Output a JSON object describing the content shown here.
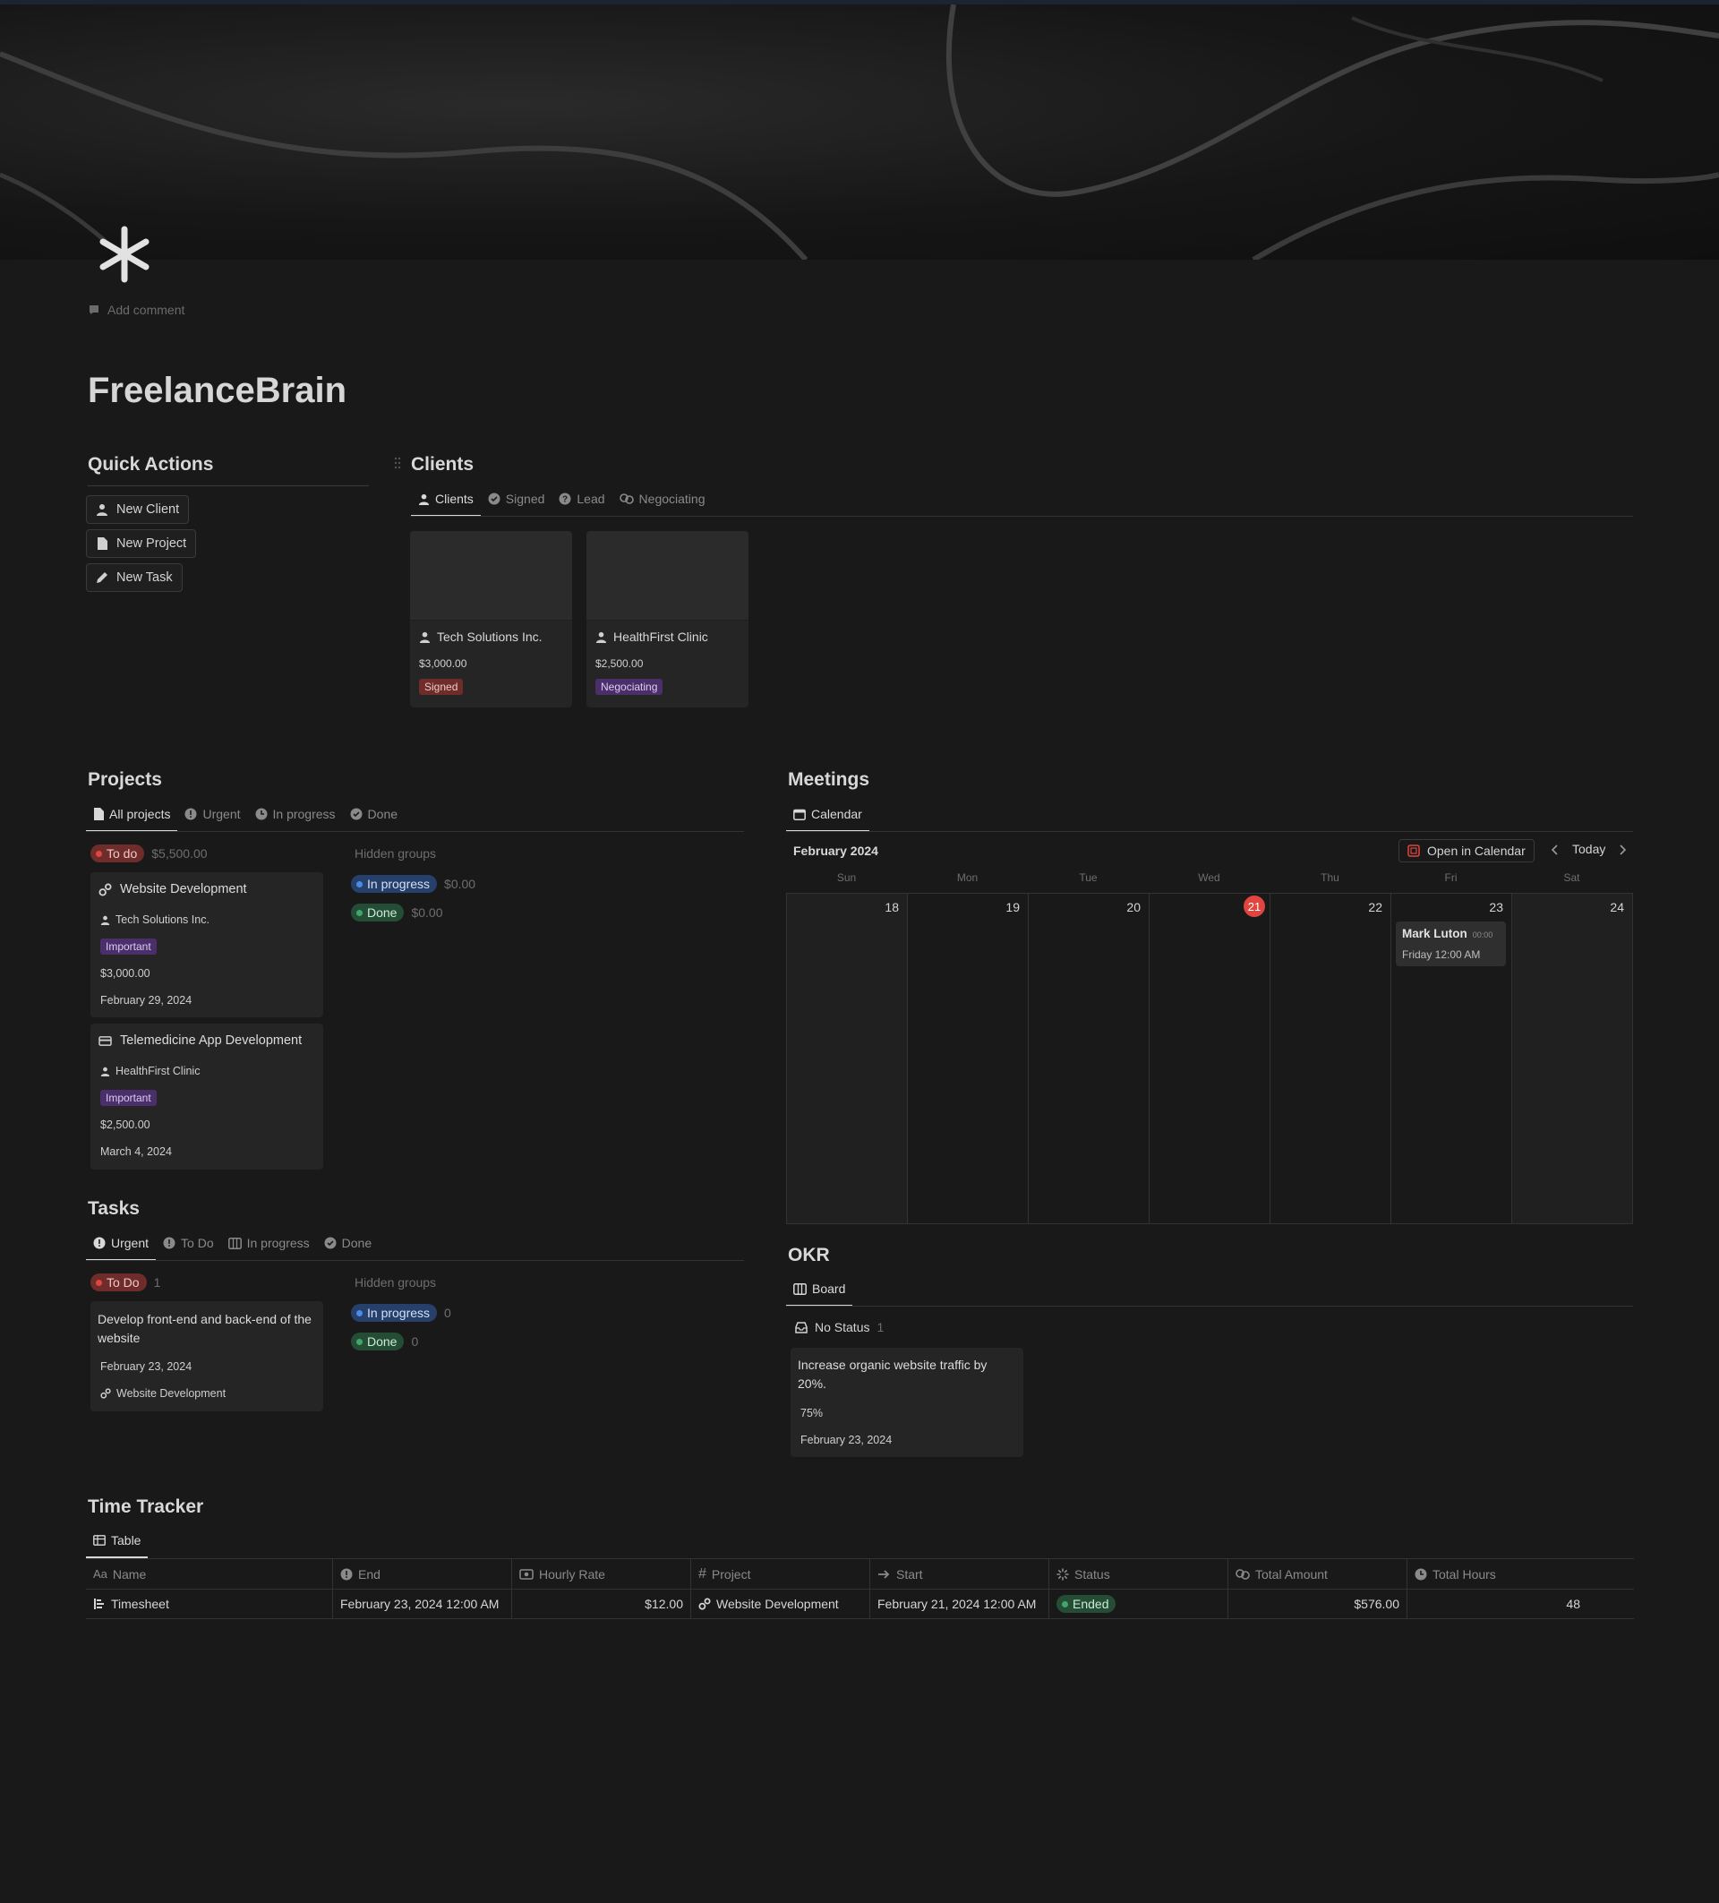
{
  "page": {
    "title": "FreelanceBrain",
    "add_comment": "Add comment"
  },
  "quick_actions": {
    "heading": "Quick Actions",
    "buttons": [
      "New Client",
      "New Project",
      "New Task"
    ]
  },
  "clients": {
    "heading": "Clients",
    "tabs": [
      "Clients",
      "Signed",
      "Lead",
      "Negociating"
    ],
    "cards": [
      {
        "name": "Tech Solutions Inc.",
        "amount": "$3,000.00",
        "status": "Signed"
      },
      {
        "name": "HealthFirst Clinic",
        "amount": "$2,500.00",
        "status": "Negociating"
      }
    ]
  },
  "projects": {
    "heading": "Projects",
    "tabs": [
      "All projects",
      "Urgent",
      "In progress",
      "Done"
    ],
    "group": {
      "label": "To do",
      "total": "$5,500.00"
    },
    "hidden_label": "Hidden groups",
    "hidden_groups": [
      {
        "label": "In progress",
        "total": "$0.00"
      },
      {
        "label": "Done",
        "total": "$0.00"
      }
    ],
    "cards": [
      {
        "title": "Website Development",
        "client": "Tech Solutions Inc.",
        "priority": "Important",
        "amount": "$3,000.00",
        "date": "February 29, 2024"
      },
      {
        "title": "Telemedicine App Development",
        "client": "HealthFirst Clinic",
        "priority": "Important",
        "amount": "$2,500.00",
        "date": "March 4, 2024"
      }
    ]
  },
  "meetings": {
    "heading": "Meetings",
    "tab": "Calendar",
    "month": "February 2024",
    "open_in_calendar": "Open in Calendar",
    "today": "Today",
    "weekdays": [
      "Sun",
      "Mon",
      "Tue",
      "Wed",
      "Thu",
      "Fri",
      "Sat"
    ],
    "days": [
      "18",
      "19",
      "20",
      "21",
      "22",
      "23",
      "24"
    ],
    "event": {
      "title": "Mark Luton",
      "time_badge": "00:00",
      "when": "Friday 12:00 AM"
    }
  },
  "tasks": {
    "heading": "Tasks",
    "tabs": [
      "Urgent",
      "To Do",
      "In progress",
      "Done"
    ],
    "group": {
      "label": "To Do",
      "count": "1"
    },
    "hidden_label": "Hidden groups",
    "hidden_groups": [
      {
        "label": "In progress",
        "count": "0"
      },
      {
        "label": "Done",
        "count": "0"
      }
    ],
    "card": {
      "title": "Develop front-end and back-end of the website",
      "date": "February 23, 2024",
      "project": "Website Development"
    }
  },
  "okr": {
    "heading": "OKR",
    "tab": "Board",
    "group": {
      "label": "No Status",
      "count": "1"
    },
    "card": {
      "title": "Increase organic website traffic by 20%.",
      "progress": "75%",
      "date": "February 23, 2024"
    }
  },
  "time_tracker": {
    "heading": "Time Tracker",
    "tab": "Table",
    "columns": [
      "Name",
      "End",
      "Hourly Rate",
      "Project",
      "Start",
      "Status",
      "Total Amount",
      "Total Hours"
    ],
    "row": {
      "name": "Timesheet",
      "end": "February 23, 2024 12:00 AM",
      "hourly_rate": "$12.00",
      "project": "Website Development",
      "start": "February 21, 2024 12:00 AM",
      "status": "Ended",
      "total_amount": "$576.00",
      "total_hours": "48"
    }
  },
  "colors": {
    "background": "#191919",
    "red_tag": "#6e2d2a",
    "purple_tag": "#4a2f6b",
    "blue_pill": "#27406b",
    "green_pill": "#254d36",
    "today_marker": "#e0453f"
  }
}
